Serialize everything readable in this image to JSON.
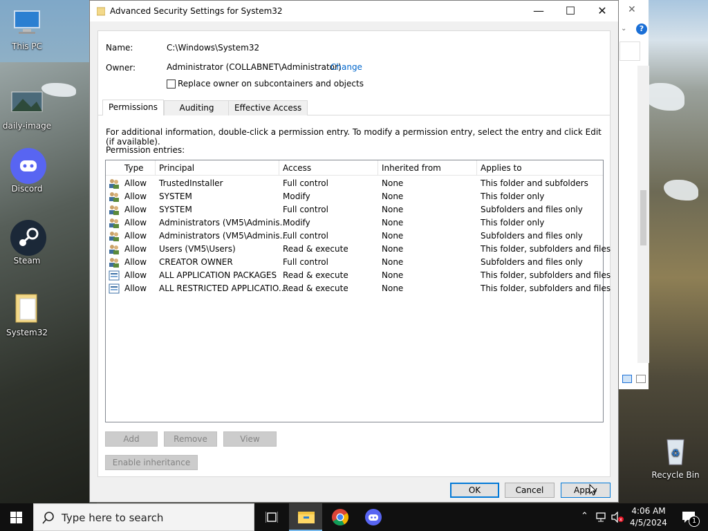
{
  "desktop": {
    "icons": [
      {
        "label": "This PC"
      },
      {
        "label": "daily-image"
      },
      {
        "label": "Discord"
      },
      {
        "label": "Steam"
      },
      {
        "label": "System32"
      },
      {
        "label": "Recycle Bin"
      }
    ]
  },
  "dialog": {
    "title": "Advanced Security Settings for System32",
    "name_label": "Name:",
    "name_value": "C:\\Windows\\System32",
    "owner_label": "Owner:",
    "owner_value": "Administrator (COLLABNET\\Administrator)",
    "change_link": "Change",
    "replace_owner_label": "Replace owner on subcontainers and objects",
    "replace_owner_checked": false,
    "tabs": [
      {
        "label": "Permissions",
        "active": true
      },
      {
        "label": "Auditing",
        "active": false
      },
      {
        "label": "Effective Access",
        "active": false
      }
    ],
    "info_text": "For additional information, double-click a permission entry. To modify a permission entry, select the entry and click Edit (if available).",
    "entries_label": "Permission entries:",
    "columns": [
      "Type",
      "Principal",
      "Access",
      "Inherited from",
      "Applies to"
    ],
    "entries": [
      {
        "icon": "user-group-icon",
        "type": "Allow",
        "principal": "TrustedInstaller",
        "access": "Full control",
        "inherited": "None",
        "applies": "This folder and subfolders"
      },
      {
        "icon": "user-group-icon",
        "type": "Allow",
        "principal": "SYSTEM",
        "access": "Modify",
        "inherited": "None",
        "applies": "This folder only"
      },
      {
        "icon": "user-group-icon",
        "type": "Allow",
        "principal": "SYSTEM",
        "access": "Full control",
        "inherited": "None",
        "applies": "Subfolders and files only"
      },
      {
        "icon": "user-group-icon",
        "type": "Allow",
        "principal": "Administrators (VM5\\Adminis...",
        "access": "Modify",
        "inherited": "None",
        "applies": "This folder only"
      },
      {
        "icon": "user-group-icon",
        "type": "Allow",
        "principal": "Administrators (VM5\\Adminis...",
        "access": "Full control",
        "inherited": "None",
        "applies": "Subfolders and files only"
      },
      {
        "icon": "user-group-icon",
        "type": "Allow",
        "principal": "Users (VM5\\Users)",
        "access": "Read & execute",
        "inherited": "None",
        "applies": "This folder, subfolders and files"
      },
      {
        "icon": "user-group-icon",
        "type": "Allow",
        "principal": "CREATOR OWNER",
        "access": "Full control",
        "inherited": "None",
        "applies": "Subfolders and files only"
      },
      {
        "icon": "app-package-icon",
        "type": "Allow",
        "principal": "ALL APPLICATION PACKAGES",
        "access": "Read & execute",
        "inherited": "None",
        "applies": "This folder, subfolders and files"
      },
      {
        "icon": "app-package-icon",
        "type": "Allow",
        "principal": "ALL RESTRICTED APPLICATIO...",
        "access": "Read & execute",
        "inherited": "None",
        "applies": "This folder, subfolders and files"
      }
    ],
    "buttons": {
      "add": "Add",
      "remove": "Remove",
      "view": "View",
      "enable_inheritance": "Enable inheritance",
      "ok": "OK",
      "cancel": "Cancel",
      "apply": "Apply"
    }
  },
  "taskbar": {
    "search_placeholder": "Type here to search",
    "time": "4:06 AM",
    "date": "4/5/2024",
    "notification_count": "1"
  },
  "colors": {
    "accent": "#0078d7",
    "link": "#0066cc",
    "taskbar": "#101010"
  }
}
